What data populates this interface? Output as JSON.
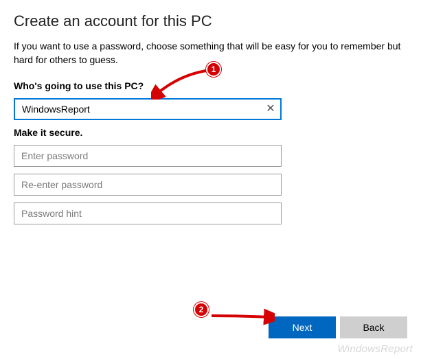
{
  "title": "Create an account for this PC",
  "instructions": "If you want to use a password, choose something that will be easy for you to remember but hard for others to guess.",
  "section1": {
    "label": "Who's going to use this PC?",
    "username": {
      "value": "WindowsReport",
      "placeholder": ""
    }
  },
  "section2": {
    "label": "Make it secure.",
    "password": {
      "placeholder": "Enter password"
    },
    "password_confirm": {
      "placeholder": "Re-enter password"
    },
    "hint": {
      "placeholder": "Password hint"
    }
  },
  "buttons": {
    "next": "Next",
    "back": "Back"
  },
  "annotations": {
    "badge1": "1",
    "badge2": "2"
  },
  "watermark": "WindowsReport",
  "colors": {
    "accent": "#0078D7",
    "primaryBtn": "#0067C0",
    "annotation": "#d40202"
  }
}
